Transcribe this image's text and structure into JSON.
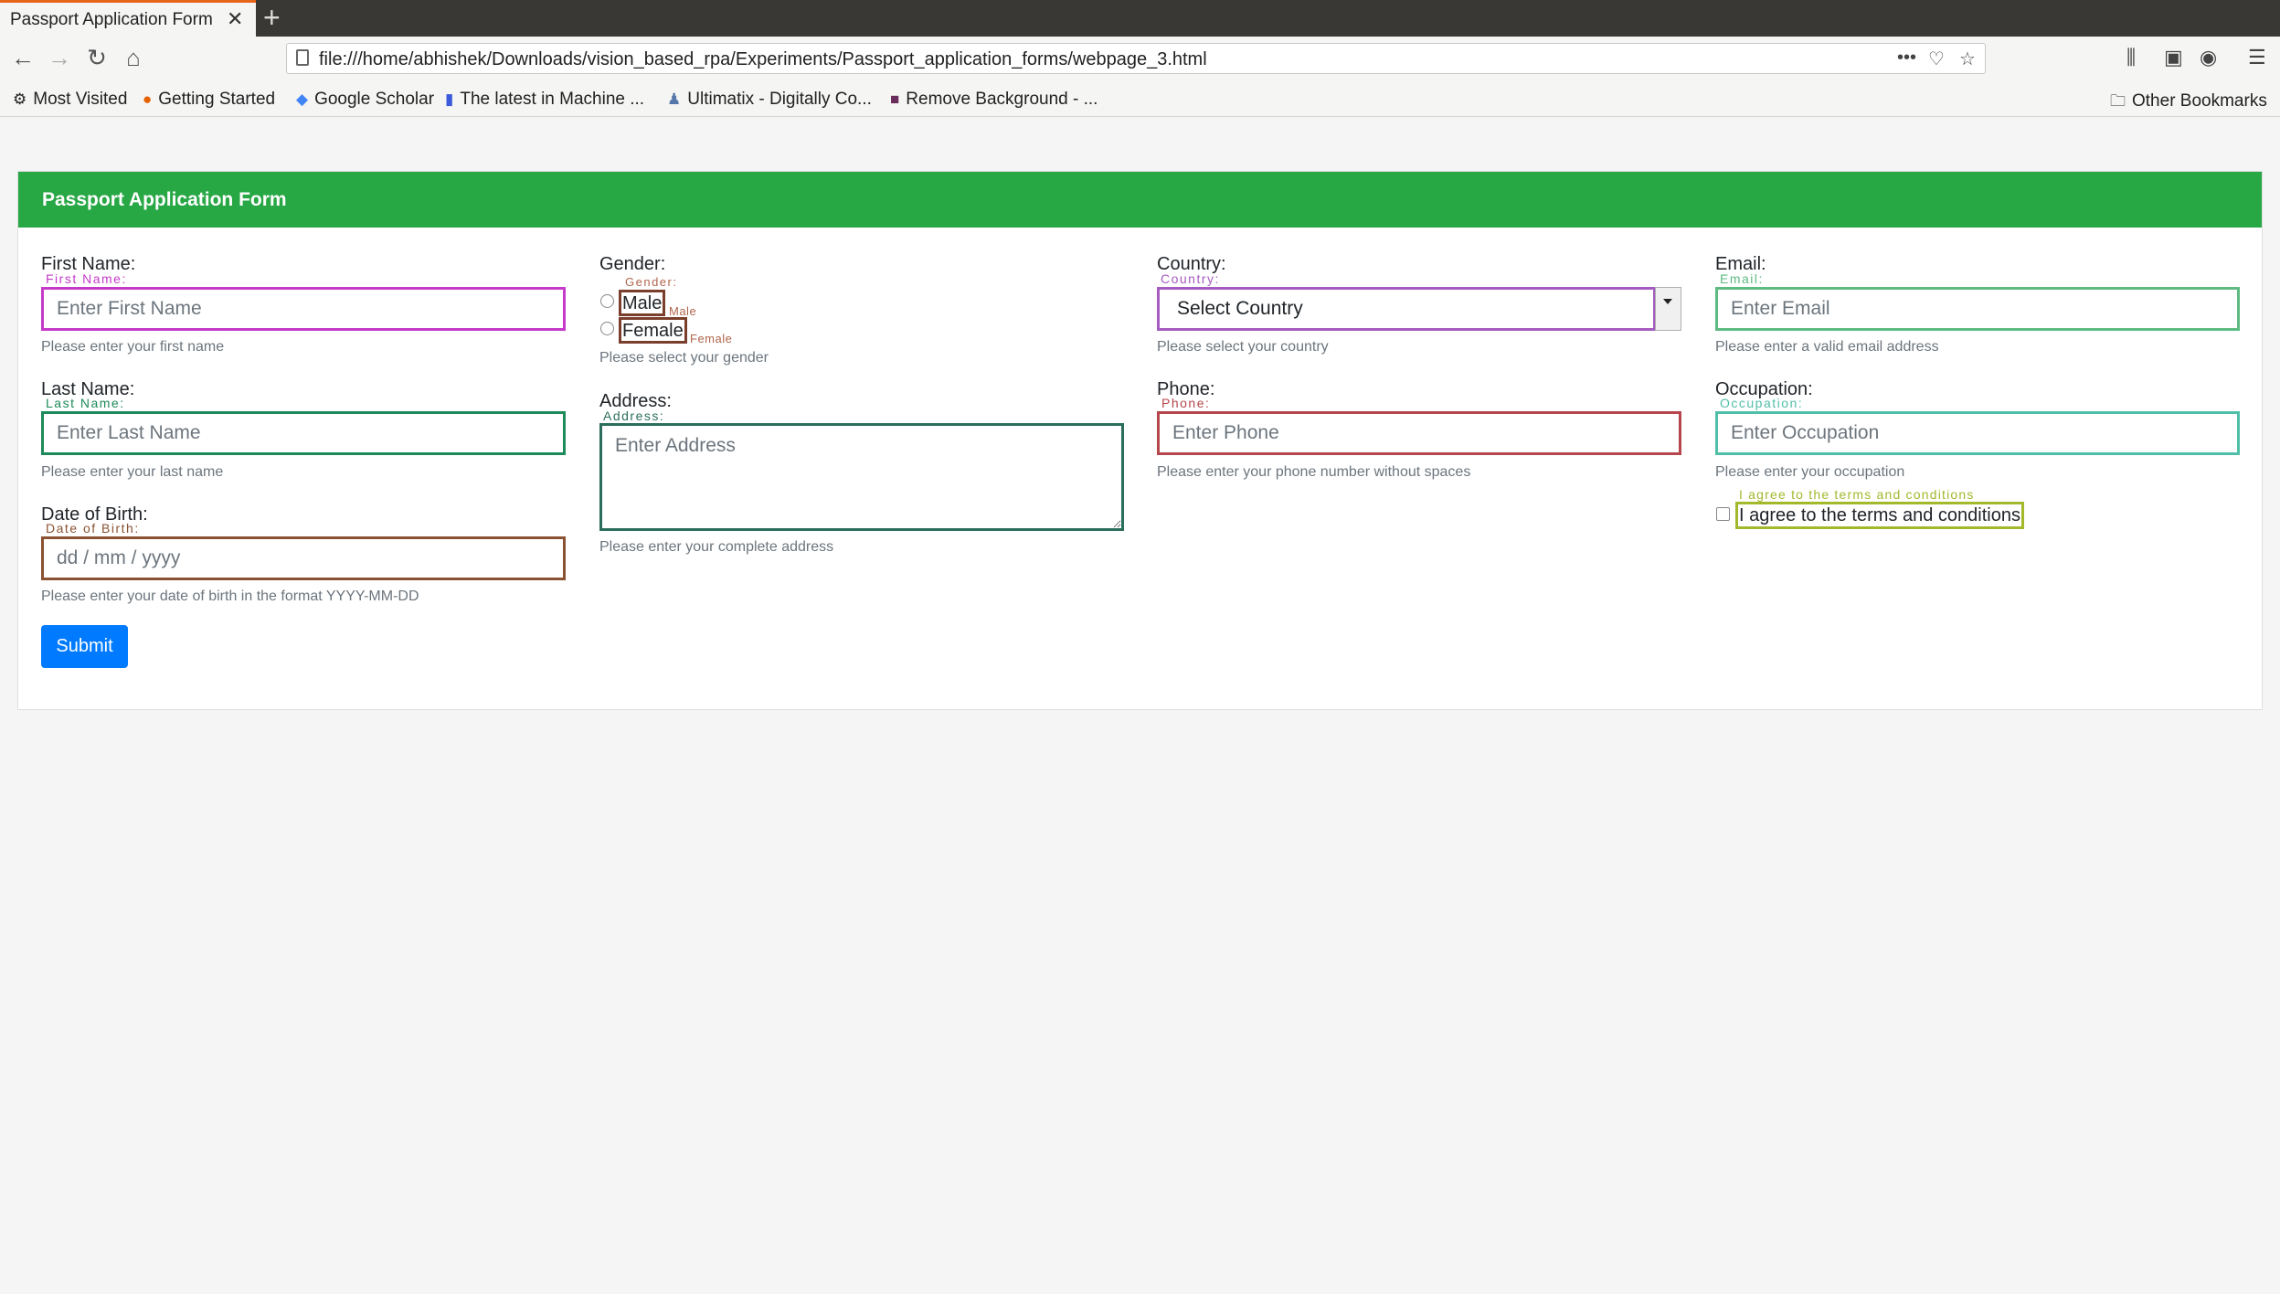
{
  "browser": {
    "tab_title": "Passport Application Form",
    "url": "file:///home/abhishek/Downloads/vision_based_rpa/Experiments/Passport_application_forms/webpage_3.html",
    "bookmarks": [
      {
        "label": "Most Visited",
        "icon": "gear-icon"
      },
      {
        "label": "Getting Started",
        "icon": "firefox-icon"
      },
      {
        "label": "Google Scholar",
        "icon": "scholar-icon"
      },
      {
        "label": "The latest in Machine ...",
        "icon": "bookmark-icon"
      },
      {
        "label": "Ultimatix - Digitally Co...",
        "icon": "people-icon"
      },
      {
        "label": "Remove Background - ...",
        "icon": "image-icon"
      }
    ],
    "other_bookmarks": "Other Bookmarks"
  },
  "form": {
    "title": "Passport Application Form",
    "first_name": {
      "label": "First Name:",
      "tag": "First Name:",
      "placeholder": "Enter First Name",
      "help": "Please enter your first name",
      "color": "#c53ac9"
    },
    "last_name": {
      "label": "Last Name:",
      "tag": "Last Name:",
      "placeholder": "Enter Last Name",
      "help": "Please enter your last name",
      "color": "#1d8a5a"
    },
    "dob": {
      "label": "Date of Birth:",
      "tag": "Date of Birth:",
      "placeholder": "dd / mm / yyyy",
      "help": "Please enter your date of birth in the format YYYY-MM-DD",
      "color": "#8a5233"
    },
    "gender": {
      "label": "Gender:",
      "tag": "Gender:",
      "male": "Male",
      "male_tag": "Male",
      "female": "Female",
      "female_tag": "Female",
      "help": "Please select your gender",
      "color": "#b0664d"
    },
    "address": {
      "label": "Address:",
      "tag": "Address:",
      "placeholder": "Enter Address",
      "help": "Please enter your complete address",
      "color": "#2c6e5c"
    },
    "country": {
      "label": "Country:",
      "tag": "Country:",
      "selected": "Select Country",
      "help": "Please select your country",
      "color": "#a55bc0"
    },
    "phone": {
      "label": "Phone:",
      "tag": "Phone:",
      "placeholder": "Enter Phone",
      "help": "Please enter your phone number without spaces",
      "color": "#b5464c"
    },
    "email": {
      "label": "Email:",
      "tag": "Email:",
      "placeholder": "Enter Email",
      "help": "Please enter a valid email address",
      "color": "#5dbb82"
    },
    "occupation": {
      "label": "Occupation:",
      "tag": "Occupation:",
      "placeholder": "Enter Occupation",
      "help": "Please enter your occupation",
      "color": "#4fbfa8"
    },
    "terms": {
      "label": "I agree to the terms and conditions",
      "tag": "I agree to the terms and conditions",
      "color": "#a4b82c"
    },
    "submit": "Submit"
  }
}
